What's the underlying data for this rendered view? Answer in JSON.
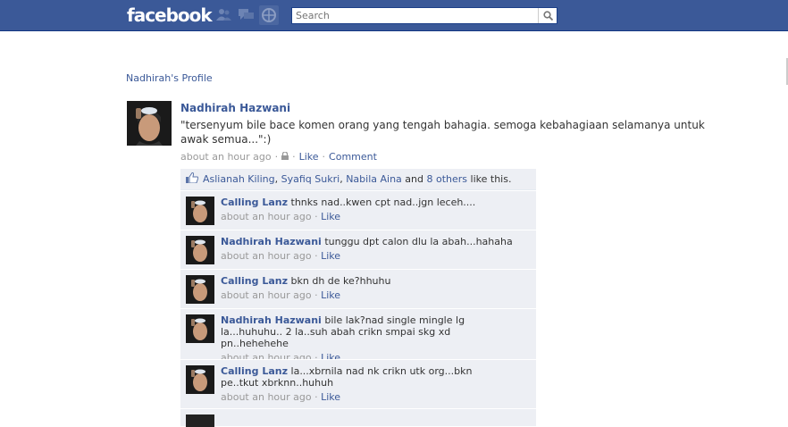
{
  "header": {
    "logo": "facebook",
    "search_placeholder": "Search",
    "colors": {
      "bar": "#3b5998",
      "link": "#3b5998"
    },
    "icons": [
      "friend-requests-icon",
      "messages-icon",
      "notifications-icon",
      "search-icon"
    ]
  },
  "breadcrumb": "Nadhirah's Profile",
  "post": {
    "author": "Nadhirah Hazwani",
    "message": "\"tersenyum bile bace komen orang yang tengah bahagia. semoga kebahagiaan selamanya untuk awak semua...\":)",
    "time": "about an hour ago",
    "like": "Like",
    "comment": "Comment"
  },
  "likes": {
    "names": [
      "Aslianah Kiling",
      "Syafiq Sukri",
      "Nabila Aina"
    ],
    "and": "and",
    "others": "8 others",
    "suffix": "like this."
  },
  "comments": [
    {
      "author": "Calling Lanz",
      "text": "thnks nad..kwen cpt nad..jgn leceh....",
      "time": "about an hour ago",
      "like": "Like"
    },
    {
      "author": "Nadhirah Hazwani",
      "text": "tunggu dpt calon dlu la abah...hahaha",
      "time": "about an hour ago",
      "like": "Like"
    },
    {
      "author": "Calling Lanz",
      "text": "bkn dh de ke?hhuhu",
      "time": "about an hour ago",
      "like": "Like"
    },
    {
      "author": "Nadhirah Hazwani",
      "text": "bile lak?nad single mingle lg la...huhuhu.. 2 la..suh abah crikn smpai skg xd pn..hehehehe",
      "time": "about an hour ago",
      "like": "Like"
    },
    {
      "author": "Calling Lanz",
      "text": "la...xbrnila nad nk crikn utk org...bkn pe..tkut xbrknn..huhuh",
      "time": "about an hour ago",
      "like": "Like"
    }
  ]
}
